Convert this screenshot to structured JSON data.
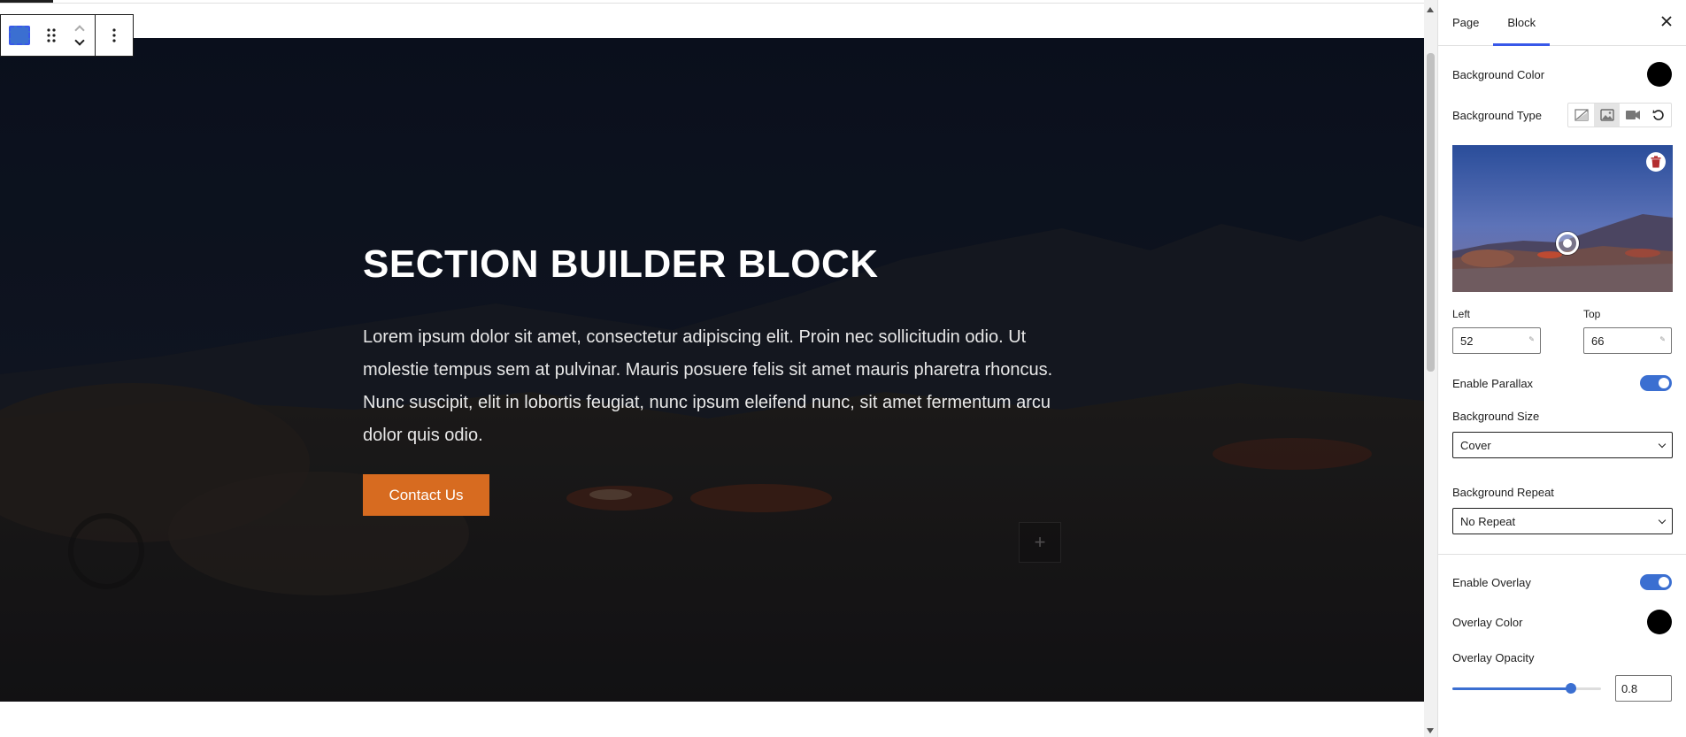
{
  "canvas": {
    "hero": {
      "title": "SECTION BUILDER BLOCK",
      "body": "Lorem ipsum dolor sit amet, consectetur adipiscing elit. Proin nec sollicitudin odio. Ut molestie tempus sem at pulvinar. Mauris posuere felis sit amet mauris pharetra rhoncus. Nunc suscipit, elit in lobortis feugiat, nunc ipsum eleifend nunc, sit amet fermentum arcu dolor quis odio.",
      "button_label": "Contact Us",
      "button_color": "#d76b20",
      "inserter_icon": "+"
    },
    "toolbar": {
      "block_icon": "section-block-icon",
      "drag_icon": "drag-handle-icon",
      "mover_up_icon": "chevron-up-icon",
      "mover_down_icon": "chevron-down-icon",
      "options_icon": "more-vertical-icon"
    }
  },
  "sidebar": {
    "tabs": [
      {
        "label": "Page"
      },
      {
        "label": "Block"
      }
    ],
    "active_tab": "Block",
    "close_icon": "close-icon",
    "background_color": {
      "label": "Background Color",
      "value": "#000000"
    },
    "background_type": {
      "label": "Background Type",
      "options": [
        "none-icon",
        "image-icon",
        "video-icon",
        "reset-icon"
      ],
      "selected": "image-icon"
    },
    "focal_point": {
      "left_label": "Left",
      "left_value": "52",
      "top_label": "Top",
      "top_value": "66"
    },
    "parallax": {
      "label": "Enable Parallax",
      "enabled": true
    },
    "background_size": {
      "label": "Background Size",
      "value": "Cover"
    },
    "background_repeat": {
      "label": "Background Repeat",
      "value": "No Repeat"
    },
    "overlay": {
      "label": "Enable Overlay",
      "enabled": true
    },
    "overlay_color": {
      "label": "Overlay Color",
      "value": "#000000"
    },
    "overlay_opacity": {
      "label": "Overlay Opacity",
      "value": "0.8",
      "fraction": 0.8
    },
    "accent_color": "#3b6fd1"
  }
}
